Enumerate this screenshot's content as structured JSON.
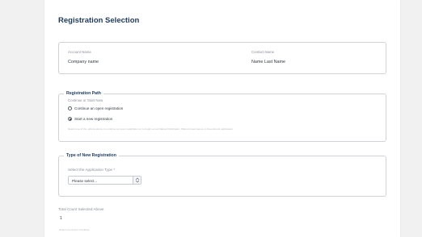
{
  "page": {
    "title": "Registration Selection"
  },
  "account": {
    "account_name_label": "Account Name",
    "account_name_value": "Company name",
    "contact_name_label": "Contact Name",
    "contact_name_value": "Name Last Name"
  },
  "registration_path": {
    "legend": "Registration Path",
    "question": "Continue or Start New",
    "options": [
      {
        "label": "Continue an open registration",
        "checked": false
      },
      {
        "label": "Start a new registration",
        "checked": true
      }
    ],
    "helper": "Select one of the options above to continue an open registration or to begin a new Market Participant, Shared Governance or Amendment application."
  },
  "type_of_new_registration": {
    "legend": "Type of New Registration",
    "select_label": "Select the Application Type *",
    "select_value": "Please select..."
  },
  "total": {
    "label": "Total Count Selected Above",
    "value": "1",
    "helper": "Select one and or Continue"
  },
  "colors": {
    "title": "#1d3a5c",
    "border": "#cfd3d8",
    "muted": "#8a9099"
  }
}
